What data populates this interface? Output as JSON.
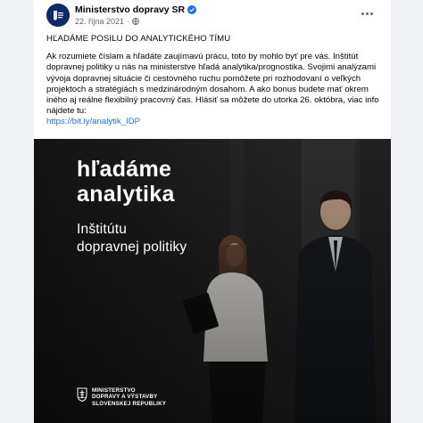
{
  "post": {
    "page_name": "Ministerstvo dopravy SR",
    "date": "22. října 2021",
    "date_separator": "·",
    "title": "HĽADÁME POSILU DO ANALYTICKÉHO TÍMU",
    "body": "Ak rozumiete číslam a hľadáte zaujímavú prácu, toto by mohlo byť pre vás. Inštitút dopravnej politiky u nás na ministerstve hľadá analytika/prognostika. Svojimi analýzami vývoja dopravnej situácie či cestovného ruchu pomôžete pri rozhodovaní o veľkých projektoch a stratégiách s medzinárodným dosahom. A ako bonus budete mať okrem iného aj reálne flexibilný pracovný čas. Hlásiť sa môžete do utorka 26. októbra, viac info nájdete tu:",
    "link": "https://bit.ly/analytik_IDP"
  },
  "image": {
    "headline_line1": "hľadáme",
    "headline_line2": "analytika",
    "sub_line1": "Inštitútu",
    "sub_line2": "dopravnej politiky",
    "logo_line1": "MINISTERSTVO",
    "logo_line2": "DOPRAVY A VÝSTAVBY",
    "logo_line3": "SLOVENSKEJ REPUBLIKY"
  },
  "icons": {
    "avatar": "ministry-logo-avatar",
    "verified": "verified-badge-icon",
    "privacy": "globe-icon",
    "more": "more-options-icon",
    "coat_of_arms": "slovak-coat-of-arms-icon"
  },
  "colors": {
    "link": "#216fdb",
    "verified": "#1b74e4",
    "avatar_bg": "#0f2a6b",
    "meta_text": "#65676b"
  }
}
